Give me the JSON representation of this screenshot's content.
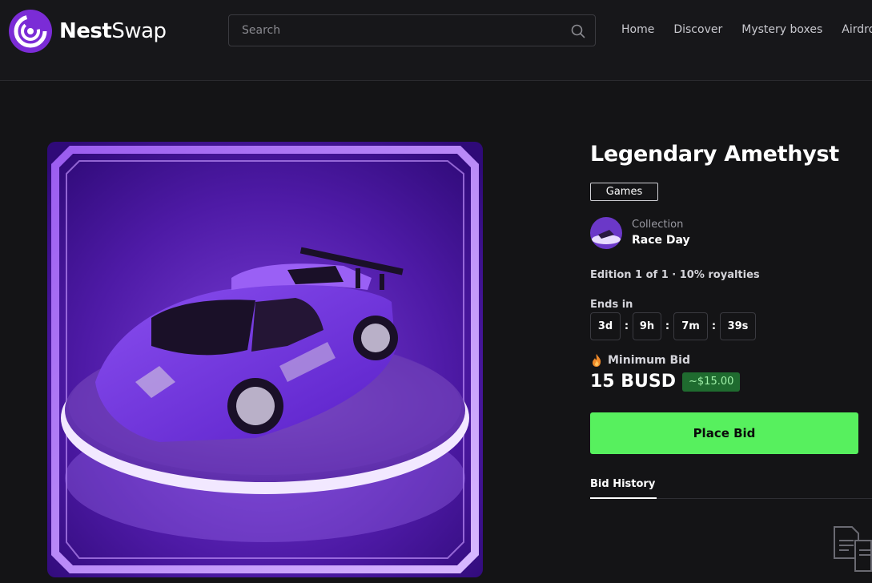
{
  "header": {
    "brand_part1": "Nest",
    "brand_part2": "Swap",
    "search_placeholder": "Search",
    "nav": [
      "Home",
      "Discover",
      "Mystery boxes",
      "Airdrop"
    ]
  },
  "item": {
    "title": "Legendary Amethyst",
    "category": "Games",
    "collection_label": "Collection",
    "collection_name": "Race Day",
    "edition": "Edition 1 of 1 · 10% royalties",
    "ends_label": "Ends in",
    "countdown": {
      "days": "3d",
      "hours": "9h",
      "minutes": "7m",
      "seconds": "39s"
    },
    "separator": ":",
    "min_bid_label": "Minimum Bid",
    "price": "15 BUSD",
    "price_usd": "~$15.00",
    "cta": "Place Bid",
    "tab": "Bid History"
  },
  "icons": [
    "nestswap-logo-icon",
    "search-icon",
    "fire-icon",
    "document-icon"
  ],
  "colors": {
    "background": "#141416",
    "accent_green": "#57f05e",
    "badge_green": "#1f6b2f",
    "brand_purple": "#7b2cd6"
  }
}
